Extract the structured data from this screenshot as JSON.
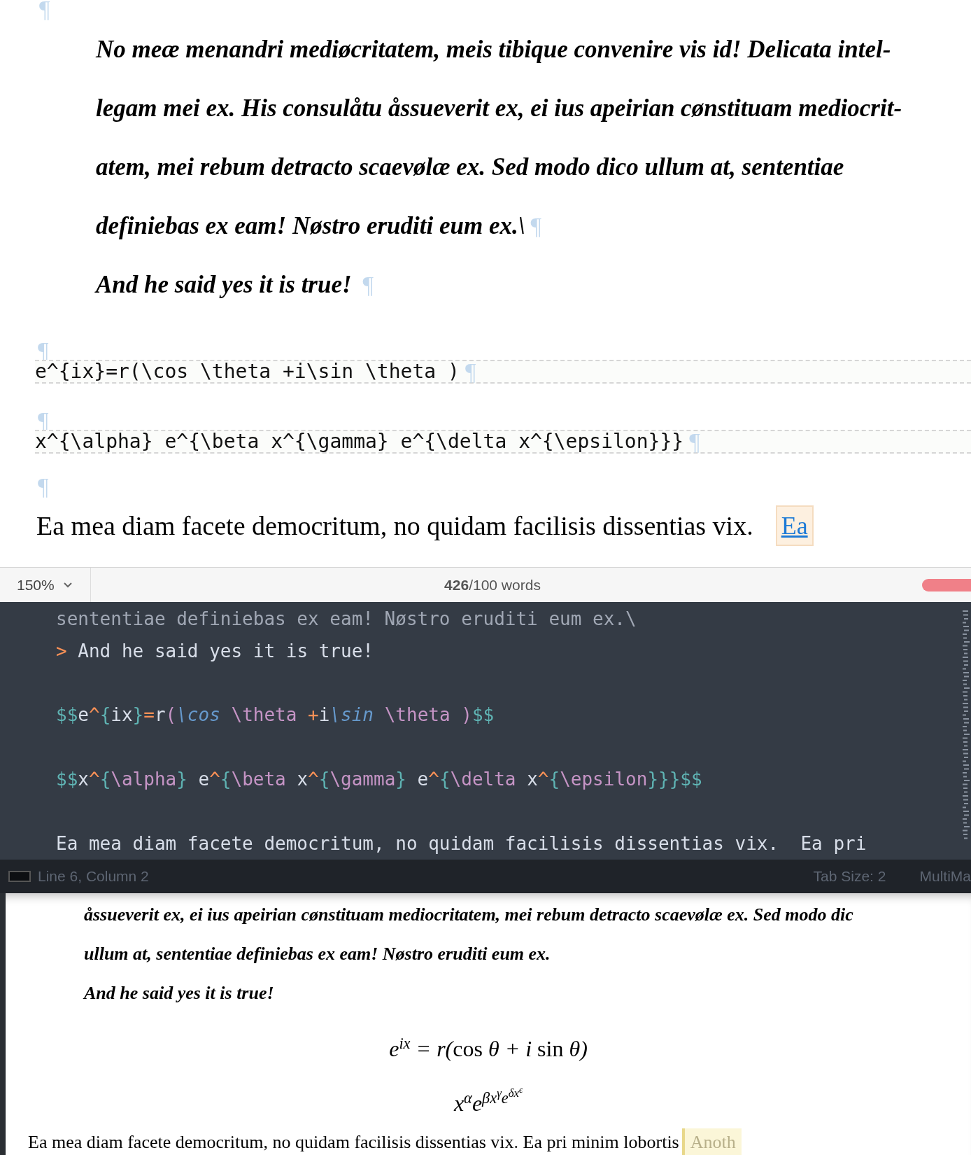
{
  "wysiwyg": {
    "pilcrow": "¶",
    "quote_lines": [
      "No meæ menandri mediøcritatem, meis tibique convenire vis id! Delicata intel-",
      "legam mei ex. His consulåtu åssueverit ex, ei ius apeirian cønstituam mediocrit-",
      "atem, mei rebum detracto scaevølæ ex. Sed modo dico ullum at, sententiae",
      "definiebas ex eam! Nøstro eruditi eum ex.\\"
    ],
    "quote_last": "And he said yes it is true!",
    "math_blocks": [
      "e^{ix}=r(\\cos \\theta +i\\sin \\theta )",
      "x^{\\alpha} e^{\\beta x^{\\gamma} e^{\\delta x^{\\epsilon}}}"
    ],
    "paragraph": "Ea mea diam facete democritum, no quidam facilisis dissentias vix.",
    "link": "Ea"
  },
  "status_bar": {
    "zoom": "150%",
    "word_count": "**426**/100 words"
  },
  "source_editor": {
    "lines": [
      {
        "spaced": false,
        "tokens": [
          {
            "kind": "dim",
            "text": "sententiae definiebas ex eam! Nøstro eruditi eum ex.\\"
          }
        ]
      },
      {
        "spaced": false,
        "tokens": [
          {
            "kind": "op",
            "text": ">"
          },
          {
            "kind": "plain",
            "text": " And he said yes it is true!"
          }
        ]
      },
      {
        "spaced": true,
        "tokens": [
          {
            "kind": "delim",
            "text": "$$"
          },
          {
            "kind": "plain",
            "text": "e"
          },
          {
            "kind": "op",
            "text": "^"
          },
          {
            "kind": "delim",
            "text": "{"
          },
          {
            "kind": "plain",
            "text": "ix"
          },
          {
            "kind": "delim",
            "text": "}"
          },
          {
            "kind": "op",
            "text": "="
          },
          {
            "kind": "plain",
            "text": "r"
          },
          {
            "kind": "cmd",
            "text": "("
          },
          {
            "kind": "fn",
            "text": "\\cos"
          },
          {
            "kind": "cmd",
            "text": " \\theta "
          },
          {
            "kind": "op",
            "text": "+"
          },
          {
            "kind": "plain",
            "text": "i"
          },
          {
            "kind": "fn",
            "text": "\\sin"
          },
          {
            "kind": "cmd",
            "text": " \\theta )"
          },
          {
            "kind": "delim",
            "text": "$$"
          }
        ]
      },
      {
        "spaced": true,
        "tokens": [
          {
            "kind": "delim",
            "text": "$$"
          },
          {
            "kind": "plain",
            "text": "x"
          },
          {
            "kind": "op",
            "text": "^"
          },
          {
            "kind": "delim",
            "text": "{"
          },
          {
            "kind": "cmd",
            "text": "\\alpha"
          },
          {
            "kind": "delim",
            "text": "}"
          },
          {
            "kind": "plain",
            "text": " e"
          },
          {
            "kind": "op",
            "text": "^"
          },
          {
            "kind": "delim",
            "text": "{"
          },
          {
            "kind": "cmd",
            "text": "\\beta"
          },
          {
            "kind": "plain",
            "text": " x"
          },
          {
            "kind": "op",
            "text": "^"
          },
          {
            "kind": "delim",
            "text": "{"
          },
          {
            "kind": "cmd",
            "text": "\\gamma"
          },
          {
            "kind": "delim",
            "text": "}"
          },
          {
            "kind": "plain",
            "text": " e"
          },
          {
            "kind": "op",
            "text": "^"
          },
          {
            "kind": "delim",
            "text": "{"
          },
          {
            "kind": "cmd",
            "text": "\\delta"
          },
          {
            "kind": "plain",
            "text": " x"
          },
          {
            "kind": "op",
            "text": "^"
          },
          {
            "kind": "delim",
            "text": "{"
          },
          {
            "kind": "cmd",
            "text": "\\epsilon"
          },
          {
            "kind": "delim",
            "text": "}}}$$"
          }
        ]
      },
      {
        "spaced": true,
        "tokens": [
          {
            "kind": "plain",
            "text": "Ea mea diam facete democritum, no quidam facilisis dissentias vix.  Ea pri"
          }
        ]
      }
    ],
    "status": {
      "position": "Line 6, Column 2",
      "tab_size": "Tab Size: 2",
      "syntax": "MultiMa"
    }
  },
  "preview": {
    "quote_lines": [
      "åssueverit ex, ei ius apeirian cønstituam mediocritatem, mei rebum detracto scaevølæ ex. Sed modo dic",
      "ullum at, sententiae definiebas ex eam! Nøstro eruditi eum ex.",
      "And he said yes it is true!"
    ],
    "formulas": [
      [
        {
          "text": "e",
          "sup": [
            {
              "text": "ix"
            }
          ]
        },
        {
          "text": " = r("
        },
        {
          "text": "cos",
          "upright": true
        },
        {
          "text": " θ + i "
        },
        {
          "text": "sin",
          "upright": true
        },
        {
          "text": " θ)"
        }
      ],
      [
        {
          "text": "x",
          "sup": [
            {
              "text": "α"
            }
          ]
        },
        {
          "text": "e",
          "sup": [
            {
              "text": "βx",
              "sup": [
                {
                  "text": "γ"
                }
              ]
            },
            {
              "text": "e",
              "sup": [
                {
                  "text": "δx",
                  "sup": [
                    {
                      "text": "ϵ"
                    }
                  ]
                }
              ]
            }
          ]
        }
      ]
    ],
    "paragraph": "Ea mea diam facete democritum, no quidam facilisis dissentias vix. Ea pri minim lobortis",
    "comment": "Anoth"
  }
}
